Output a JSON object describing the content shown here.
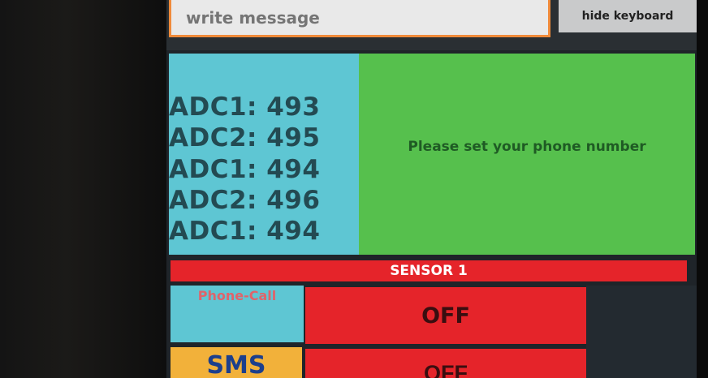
{
  "message": {
    "placeholder": "write message"
  },
  "keyboard": {
    "hide_label": "hide keyboard"
  },
  "adc_readings": [
    "ADC1: 493",
    "ADC2: 495",
    "ADC1: 494",
    "ADC2: 496",
    "ADC1: 494"
  ],
  "status": {
    "text": "Please set your phone number"
  },
  "sensor": {
    "title": "SENSOR 1",
    "phone_call": {
      "label": "Phone-Call",
      "state": "OFF"
    },
    "sms": {
      "label": "SMS",
      "state": "OFF"
    }
  },
  "colors": {
    "adc_bg": "#5ec6d3",
    "status_bg": "#56c04d",
    "sensor_red": "#e5242a",
    "sms_orange": "#f2b13a",
    "input_border": "#f08a3a"
  }
}
